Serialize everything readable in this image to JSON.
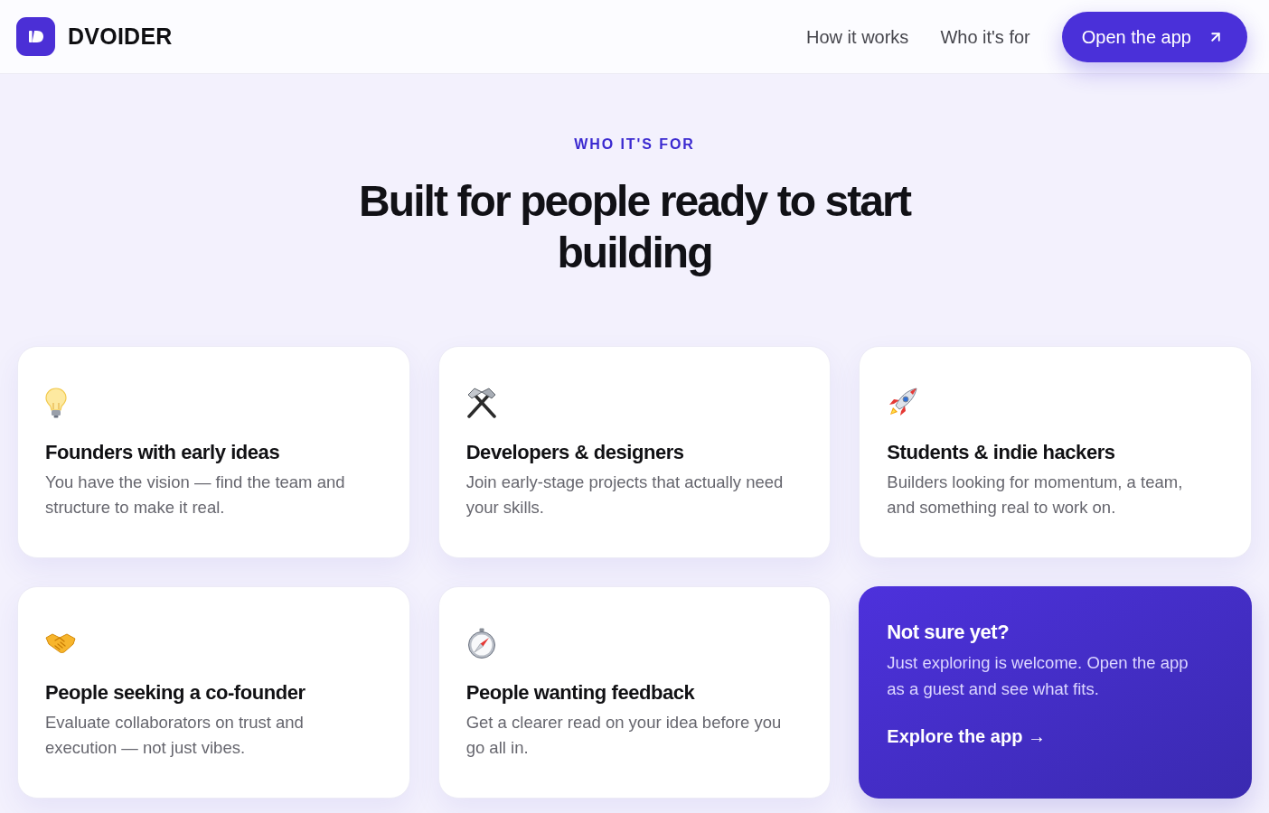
{
  "header": {
    "brand": "DVOIDER",
    "nav": [
      "How it works",
      "Who it's for"
    ],
    "cta": "Open the app"
  },
  "section": {
    "eyebrow": "WHO IT'S FOR",
    "title": "Built for people ready to start building",
    "cards": [
      {
        "kind": "audience",
        "title": "Founders with early ideas",
        "description": "You have the vision — find the team and structure to make it real."
      },
      {
        "kind": "audience",
        "title": "Developers & designers",
        "description": "Join early-stage projects that actually need your skills."
      },
      {
        "kind": "audience",
        "title": "Students & indie hackers",
        "description": "Builders looking for momentum, a team, and something real to work on."
      },
      {
        "kind": "audience",
        "title": "People seeking a co-founder",
        "description": "Evaluate collaborators on trust and execution — not just vibes."
      },
      {
        "kind": "audience",
        "title": "People wanting feedback",
        "description": "Get a clearer read on your idea before you go all in."
      },
      {
        "kind": "cta",
        "title": "Not sure yet?",
        "description": "Just exploring is welcome. Open the app as a guest and see what fits.",
        "link": "Explore the app →"
      }
    ]
  }
}
